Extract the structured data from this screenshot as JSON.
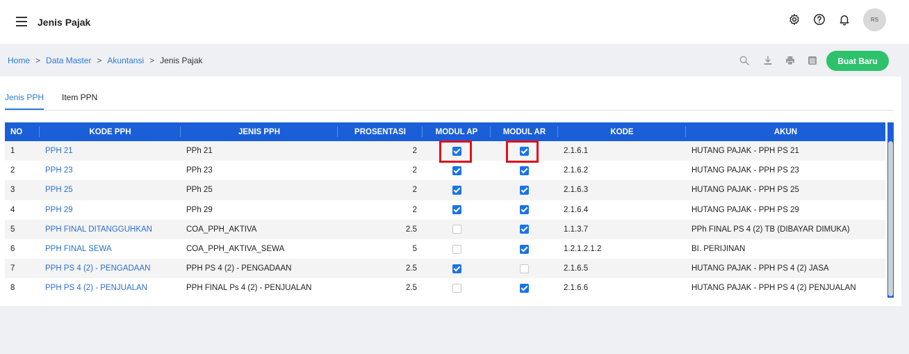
{
  "header": {
    "title": "Jenis Pajak",
    "avatar_text": "RS"
  },
  "breadcrumb": {
    "items": [
      "Home",
      "Data Master",
      "Akuntansi"
    ],
    "current": "Jenis Pajak",
    "separator": ">"
  },
  "toolbar": {
    "new_label": "Buat Baru"
  },
  "tabs": [
    {
      "label": "Jenis PPH",
      "active": true
    },
    {
      "label": "Item PPN",
      "active": false
    }
  ],
  "table": {
    "columns": [
      "NO",
      "KODE PPH",
      "JENIS PPH",
      "PROSENTASI",
      "MODUL AP",
      "MODUL AR",
      "KODE",
      "AKUN"
    ],
    "rows": [
      {
        "no": "1",
        "kode_pph": "PPH 21",
        "jenis_pph": "PPh 21",
        "prosentasi": "2",
        "modul_ap": true,
        "modul_ar": true,
        "kode": "2.1.6.1",
        "akun": "HUTANG PAJAK - PPH PS 21"
      },
      {
        "no": "2",
        "kode_pph": "PPH 23",
        "jenis_pph": "PPh 23",
        "prosentasi": "2",
        "modul_ap": true,
        "modul_ar": true,
        "kode": "2.1.6.2",
        "akun": "HUTANG PAJAK - PPH PS 23"
      },
      {
        "no": "3",
        "kode_pph": "PPH 25",
        "jenis_pph": "PPh 25",
        "prosentasi": "2",
        "modul_ap": true,
        "modul_ar": true,
        "kode": "2.1.6.3",
        "akun": "HUTANG PAJAK - PPH PS 25"
      },
      {
        "no": "4",
        "kode_pph": "PPH 29",
        "jenis_pph": "PPh 29",
        "prosentasi": "2",
        "modul_ap": true,
        "modul_ar": true,
        "kode": "2.1.6.4",
        "akun": "HUTANG PAJAK - PPH PS 29"
      },
      {
        "no": "5",
        "kode_pph": "PPH FINAL DITANGGUHKAN",
        "jenis_pph": "COA_PPH_AKTIVA",
        "prosentasi": "2.5",
        "modul_ap": false,
        "modul_ar": true,
        "kode": "1.1.3.7",
        "akun": "PPh FINAL PS 4 (2) TB (DIBAYAR DIMUKA)"
      },
      {
        "no": "6",
        "kode_pph": "PPH FINAL SEWA",
        "jenis_pph": "COA_PPH_AKTIVA_SEWA",
        "prosentasi": "5",
        "modul_ap": false,
        "modul_ar": true,
        "kode": "1.2.1.2.1.2",
        "akun": "BI. PERIJINAN"
      },
      {
        "no": "7",
        "kode_pph": "PPH PS 4 (2) - PENGADAAN",
        "jenis_pph": "PPH PS 4 (2) - PENGADAAN",
        "prosentasi": "2.5",
        "modul_ap": true,
        "modul_ar": false,
        "kode": "2.1.6.5",
        "akun": "HUTANG PAJAK - PPH PS 4 (2) JASA"
      },
      {
        "no": "8",
        "kode_pph": "PPH PS 4 (2) - PENJUALAN",
        "jenis_pph": "PPH FINAL Ps 4 (2) - PENJUALAN",
        "prosentasi": "2.5",
        "modul_ap": false,
        "modul_ar": true,
        "kode": "2.1.6.6",
        "akun": "HUTANG PAJAK - PPH PS 4 (2) PENJUALAN"
      }
    ]
  },
  "colors": {
    "accent": "#1a5fd8",
    "link": "#2d7ad6",
    "button": "#2ec26d",
    "highlight": "#e0101d"
  }
}
